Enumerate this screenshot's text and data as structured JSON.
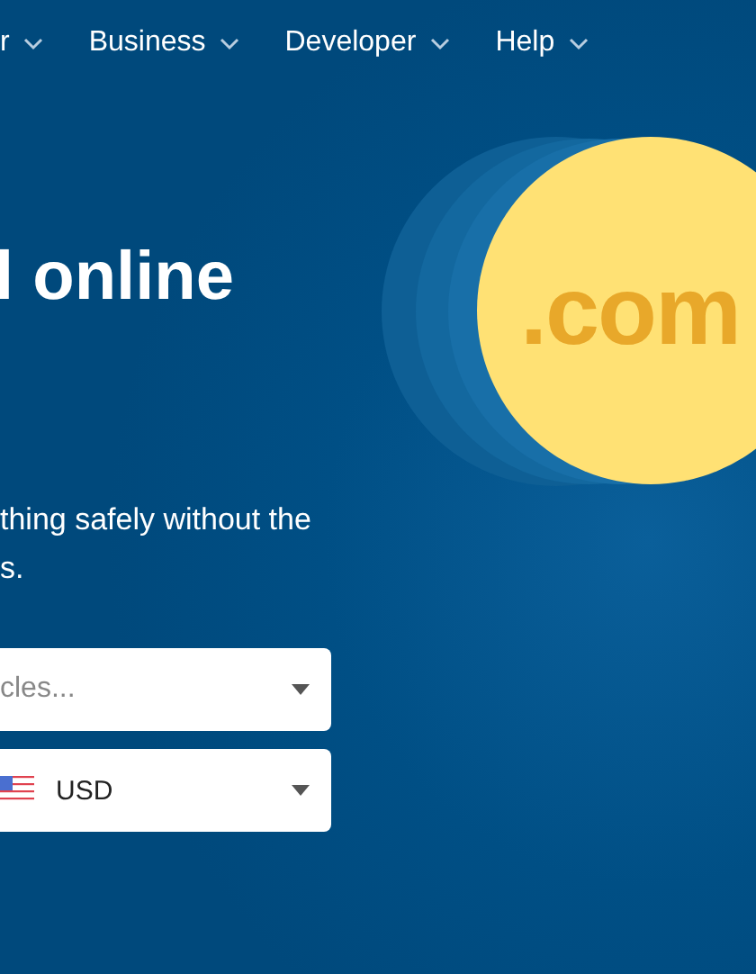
{
  "nav": [
    {
      "label": "r"
    },
    {
      "label": "Business"
    },
    {
      "label": "Developer"
    },
    {
      "label": "Help"
    }
  ],
  "hero": {
    "headline": "l online",
    "description": "thing safely without the\ns.",
    "badge": ".com"
  },
  "selects": [
    {
      "kind": "text",
      "placeholder": "cles..."
    },
    {
      "kind": "currency",
      "value": "USD"
    }
  ]
}
